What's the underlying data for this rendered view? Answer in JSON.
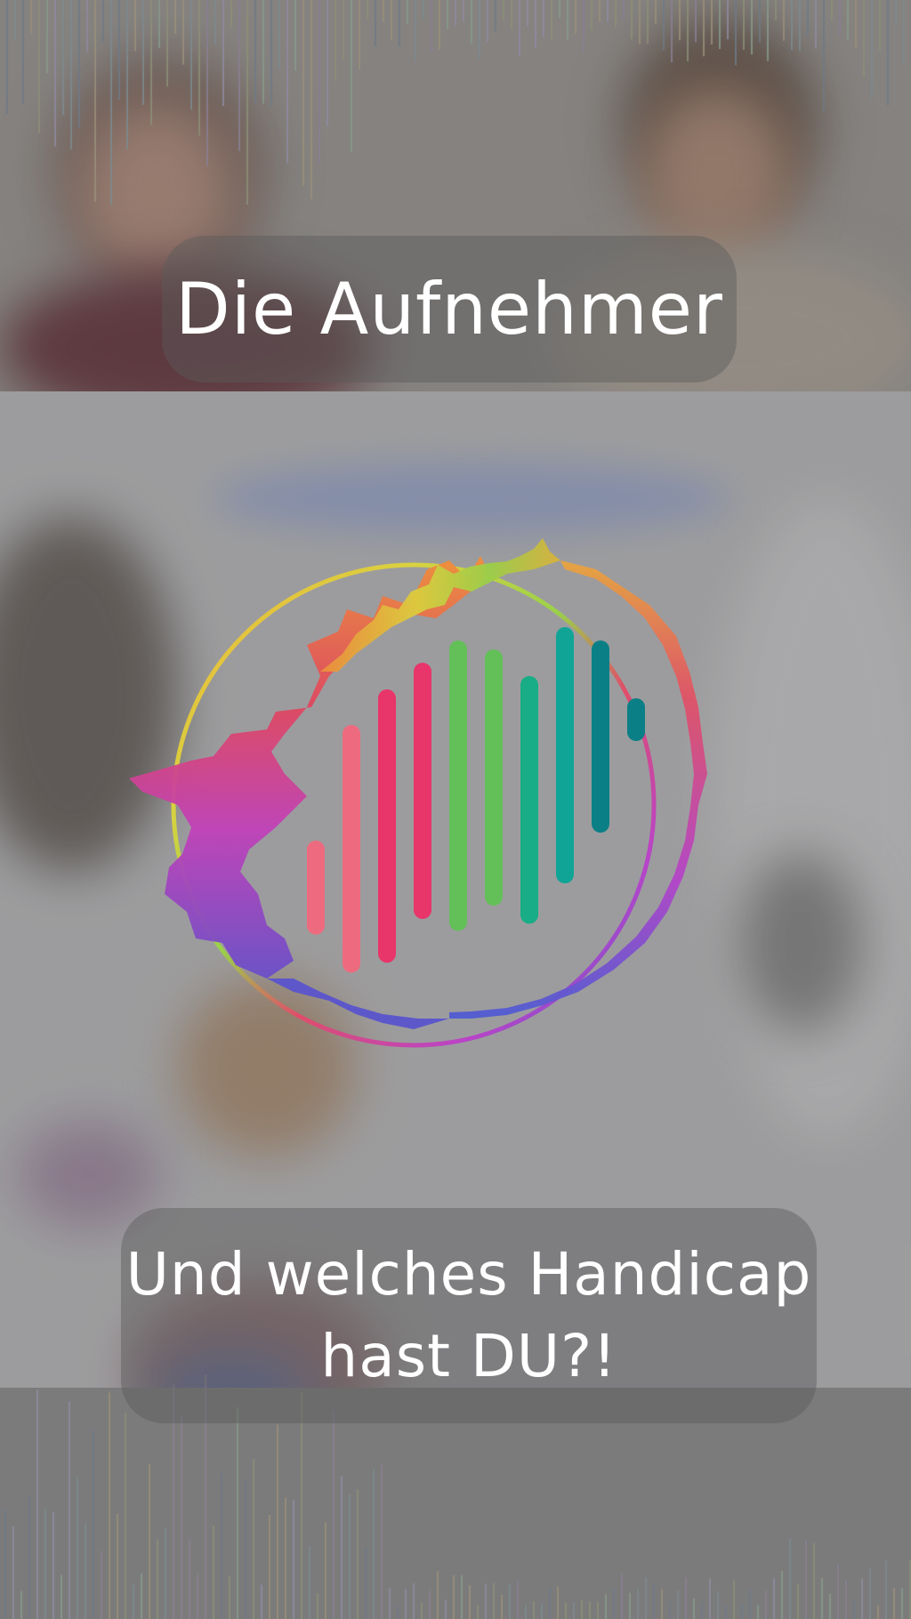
{
  "title": "Die Aufnehmer",
  "caption": {
    "line1": "Und welches Handicap",
    "line2": "hast DU?!"
  },
  "visualizer": {
    "bar_levels": [
      0.22,
      0.58,
      0.64,
      0.6,
      0.68,
      0.6,
      0.58,
      0.6,
      0.45,
      0.1
    ],
    "bar_colors": [
      "#ee6b7f",
      "#ee6b7f",
      "#e8356a",
      "#e8356a",
      "#63bf58",
      "#63bf58",
      "#18ad86",
      "#0fa496",
      "#0b7f86",
      "#0b7f86"
    ]
  },
  "icons": [
    "audio-waveform-ring-icon",
    "equalizer-bars-icon"
  ]
}
